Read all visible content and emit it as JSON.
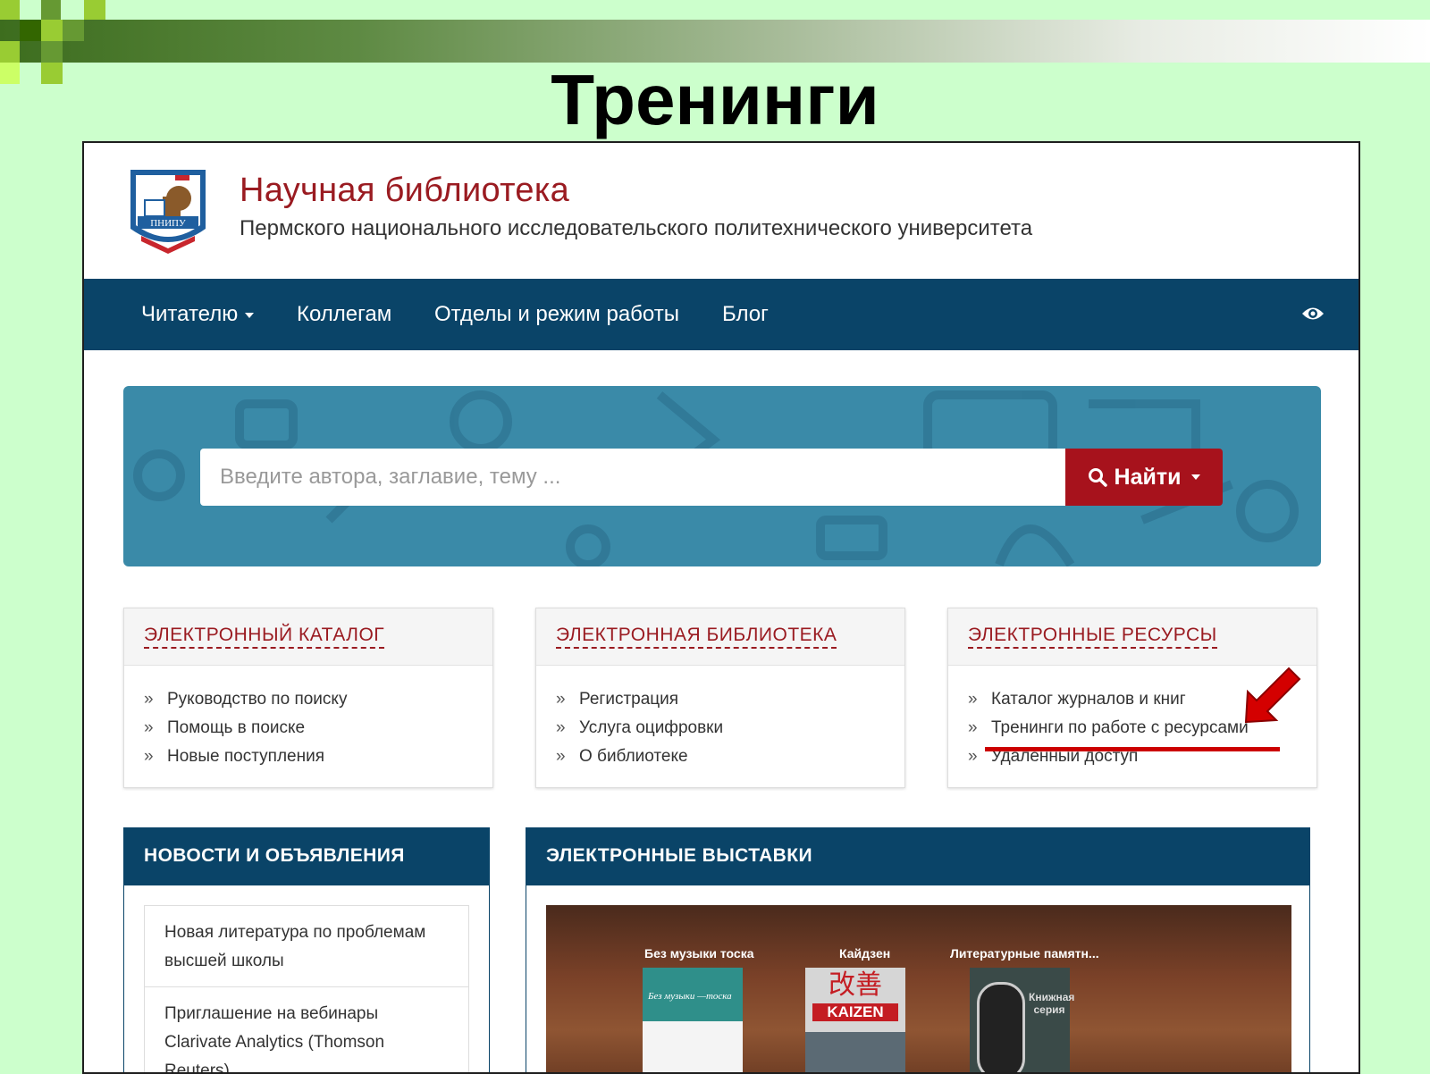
{
  "slide": {
    "title": "Тренинги"
  },
  "header": {
    "logo_text": "ПНИПУ",
    "title": "Научная библиотека",
    "subtitle": "Пермского национального исследовательского политехнического университета"
  },
  "nav": {
    "items": [
      "Читателю",
      "Коллегам",
      "Отделы и режим работы",
      "Блог"
    ]
  },
  "search": {
    "placeholder": "Введите автора, заглавие, тему ...",
    "button_label": "Найти"
  },
  "panels": [
    {
      "title": "ЭЛЕКТРОННЫЙ КАТАЛОГ",
      "links": [
        "Руководство по поиску",
        "Помощь в поиске",
        "Новые поступления"
      ]
    },
    {
      "title": "ЭЛЕКТРОННАЯ БИБЛИОТЕКА",
      "links": [
        "Регистрация",
        "Услуга оцифровки",
        "О библиотеке"
      ]
    },
    {
      "title": "ЭЛЕКТРОННЫЕ РЕСУРСЫ",
      "links": [
        "Каталог журналов и книг",
        "Тренинги по работе с ресурсами",
        "Удалённый доступ"
      ]
    }
  ],
  "news": {
    "title": "НОВОСТИ И ОБЪЯВЛЕНИЯ",
    "items": [
      "Новая литература по проблемам высшей школы",
      "Приглашение на вебинары Clarivate Analytics (Thomson Reuters),"
    ]
  },
  "exhibitions": {
    "title": "ЭЛЕКТРОННЫЕ ВЫСТАВКИ",
    "books": [
      {
        "title": "Без музыки тоска",
        "cover_text": "Без музыки —тоска"
      },
      {
        "title": "Кайдзен",
        "cover_text": "KAIZEN",
        "cover_glyphs": "改善"
      },
      {
        "title": "Литературные памятн...",
        "cover_text": "Книжная серия"
      }
    ]
  },
  "colors": {
    "slide_bg": "#ccffcc",
    "nav_bg": "#0a4468",
    "brand_red": "#9a1b21",
    "search_button": "#a7121c",
    "hero_bg": "#3a8aa8",
    "annotation_red": "#cc0000"
  },
  "icons": [
    "logo-icon",
    "caret-down-icon",
    "eye-icon",
    "search-icon",
    "raquo-icon",
    "annotation-arrow-icon"
  ]
}
